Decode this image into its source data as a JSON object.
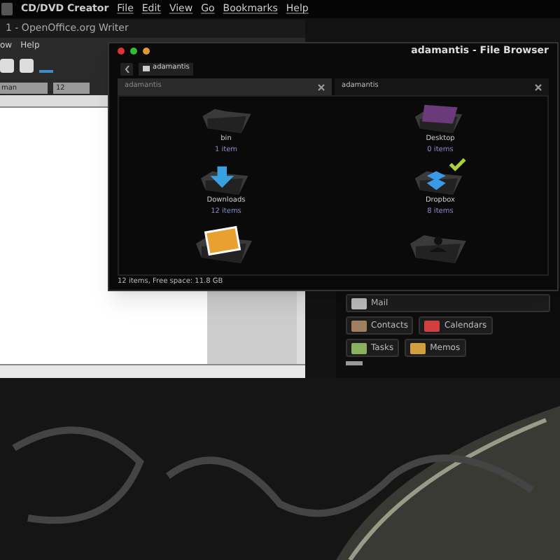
{
  "top_panel": {
    "app_name": "CD/DVD Creator",
    "menu": [
      "File",
      "Edit",
      "View",
      "Go",
      "Bookmarks",
      "Help"
    ]
  },
  "writer_window": {
    "title": "1 - OpenOffice.org Writer",
    "menu": [
      "ow",
      "Help"
    ],
    "font_name": "man",
    "font_size": "12"
  },
  "file_browser": {
    "title": "adamantis - File Browser",
    "breadcrumb": "adamantis",
    "tabs": [
      {
        "label": "adamantis",
        "selected": false
      },
      {
        "label": "adamantis",
        "selected": true
      }
    ],
    "items": [
      {
        "kind": "folder",
        "name": "bin",
        "count": "1 item"
      },
      {
        "kind": "desktop",
        "name": "Desktop",
        "count": "0 items"
      },
      {
        "kind": "downloads",
        "name": "Downloads",
        "count": "12 items"
      },
      {
        "kind": "dropbox",
        "name": "Dropbox",
        "count": "8 items"
      },
      {
        "kind": "pictures"
      },
      {
        "kind": "user"
      }
    ],
    "status": "12 items, Free space: 11.8 GB"
  },
  "launcher": {
    "buttons": [
      {
        "kind": "mail",
        "label": "Mail"
      },
      {
        "kind": "contacts",
        "label": "Contacts"
      },
      {
        "kind": "calendar",
        "label": "Calendars"
      },
      {
        "kind": "tasks",
        "label": "Tasks"
      },
      {
        "kind": "memos",
        "label": "Memos"
      }
    ]
  }
}
